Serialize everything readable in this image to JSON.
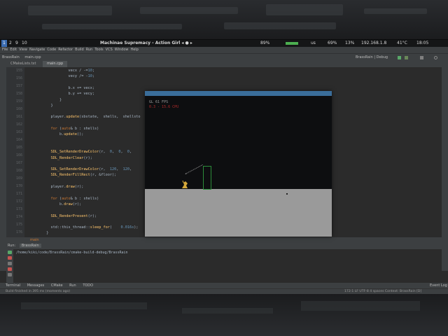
{
  "topbar": {
    "workspaces": [
      "1",
      "2",
      "9",
      "10"
    ],
    "window_title": "Machinae Supremacy - Action Girl  ◂ ● ▸",
    "battery": "89%",
    "temp_a": "us",
    "cpu": "69%",
    "mem": "13%",
    "ip": "192.168.1.8",
    "temp": "41°C",
    "time": "18:05"
  },
  "ide": {
    "menu": [
      "File",
      "Edit",
      "View",
      "Navigate",
      "Code",
      "Refactor",
      "Build",
      "Run",
      "Tools",
      "VCS",
      "Window",
      "Help"
    ],
    "project": "BrassRain",
    "file": "main.cpp",
    "run_config": "BrassRain | Debug",
    "tabs": [
      "CMakeLists.txt",
      "main.cpp"
    ],
    "line_numbers": [
      "155",
      "156",
      "157",
      "158",
      "159",
      "160",
      "161",
      "162",
      "163",
      "164",
      "165",
      "166",
      "167",
      "168",
      "169",
      "170",
      "171",
      "172",
      "173",
      "174",
      "175",
      "176"
    ],
    "code_lines": [
      "            vecx / -=10;",
      "            vecy /= -10;",
      "",
      "            b.x += vecx;",
      "            b.y += vecy;",
      "        }",
      "    }",
      "",
      "    player.update(sbstate,  shells,  shellsto",
      "",
      "    for (auto& b : shells)",
      "        b.update();",
      "",
      "",
      "    SDL_SetRenderDrawColor(r,  0,  0,  0,",
      "    SDL_RenderClear(r);",
      "",
      "    SDL_SetRenderDrawColor(r,  120,  120,",
      "    SDL_RenderFillRect(r, &floor);",
      "",
      "    player.draw(r);",
      "",
      "    for (auto& b : shells)",
      "        b.draw(r);",
      "",
      "    SDL_RenderPresent(r);",
      "",
      "    std::this_thread::sleep_for(    0.016s);",
      "  }"
    ],
    "breadcrumb": "main",
    "run_label": "Run:",
    "run_target": "BrassRain",
    "run_output": "/home/kiki/code/BrassRain/cmake-build-debug/BrassRain",
    "bottom_tabs": [
      "Terminal",
      "Messages",
      "CMake",
      "Run",
      "TODO"
    ],
    "event_log": "Event Log",
    "status_left": "Build finished in 395 ms (moments ago)",
    "status_right": "172:1  LF  UTF-8  4 spaces  Context: BrassRain [D]"
  },
  "game": {
    "hud_line1": "GL 61 FPS",
    "hud_line2": "0.3 - 15.6 CPU"
  },
  "colors": {
    "keyword": "#cc7832",
    "function": "#ffc66d",
    "number": "#6897bb",
    "hud_red": "#b22b2b",
    "hud_gray": "#9a9a9a"
  }
}
